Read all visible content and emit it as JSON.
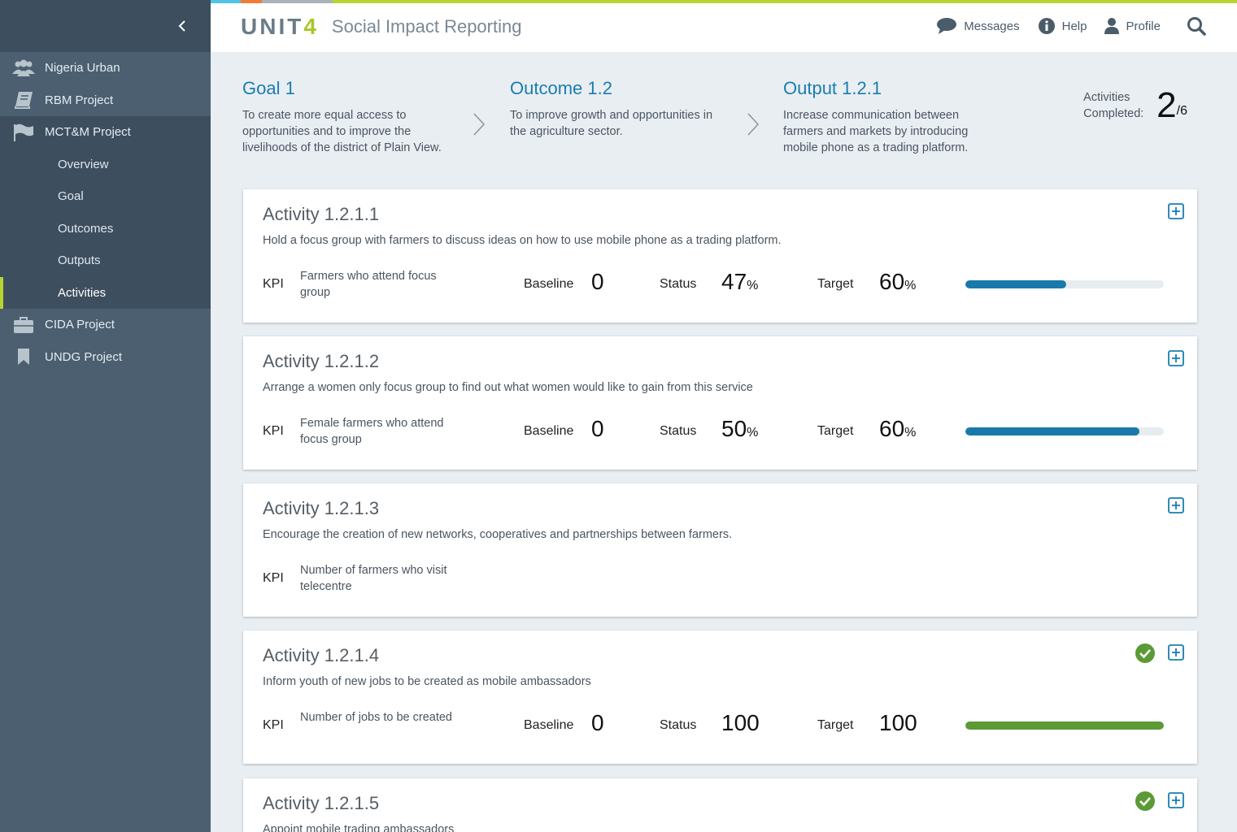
{
  "app": {
    "logo": "UNIT",
    "logo_accent": "4",
    "title": "Social Impact Reporting",
    "stripe_colors": [
      "#4fc3e8",
      "#f07c34",
      "#a9b3ba",
      "#b8d433"
    ]
  },
  "header": {
    "messages": "Messages",
    "help": "Help",
    "profile": "Profile"
  },
  "sidebar": {
    "items": [
      {
        "label": "Nigeria Urban",
        "icon": "users-icon"
      },
      {
        "label": "RBM Project",
        "icon": "book-icon"
      },
      {
        "label": "MCT&M Project",
        "icon": "flag-icon"
      },
      {
        "label": "CIDA Project",
        "icon": "briefcase-icon"
      },
      {
        "label": "UNDG Project",
        "icon": "bookmark-icon"
      }
    ],
    "subitems": [
      {
        "label": "Overview"
      },
      {
        "label": "Goal"
      },
      {
        "label": "Outcomes"
      },
      {
        "label": "Outputs"
      },
      {
        "label": "Activities"
      }
    ]
  },
  "summary": {
    "goal": {
      "title": "Goal 1",
      "text": "To create more equal access to opportunities and to improve the livelihoods of the district of Plain View."
    },
    "outcome": {
      "title": "Outcome 1.2",
      "text": "To improve growth and opportunities in the agriculture sector."
    },
    "output": {
      "title": "Output 1.2.1",
      "text": "Increase communication between farmers and markets by introducing mobile phone as a trading platform."
    },
    "completed_label": "Activities Completed:",
    "completed": "2",
    "total": "/6"
  },
  "labels": {
    "kpi": "KPI",
    "baseline": "Baseline",
    "status": "Status",
    "target": "Target"
  },
  "activities": [
    {
      "title": "Activity 1.2.1.1",
      "description": "Hold a focus group with farmers to discuss ideas on how to use mobile phone as a trading platform.",
      "kpi": "Farmers who attend focus group",
      "baseline": "0",
      "status": "47",
      "status_unit": "%",
      "target": "60",
      "target_unit": "%",
      "progress": 0.51,
      "bar_color": "#1a79ab",
      "completed": false
    },
    {
      "title": "Activity 1.2.1.2",
      "description": "Arrange a women only focus group to find out what women would like to gain from this service",
      "kpi": "Female farmers who attend focus group",
      "baseline": "0",
      "status": "50",
      "status_unit": "%",
      "target": "60",
      "target_unit": "%",
      "progress": 0.875,
      "bar_color": "#1a79ab",
      "completed": false
    },
    {
      "title": "Activity 1.2.1.3",
      "description": "Encourage the creation of new networks, cooperatives and partnerships between farmers.",
      "kpi": "Number of farmers who visit telecentre",
      "completed": false
    },
    {
      "title": "Activity 1.2.1.4",
      "description": "Inform youth of new jobs to be created as mobile ambassadors",
      "kpi": "Number of jobs to be created",
      "baseline": "0",
      "status": "100",
      "status_unit": "",
      "target": "100",
      "target_unit": "",
      "progress": 1.0,
      "bar_color": "#5b9a34",
      "completed": true
    },
    {
      "title": "Activity 1.2.1.5",
      "description": "Appoint mobile trading ambassadors",
      "completed": true
    }
  ]
}
